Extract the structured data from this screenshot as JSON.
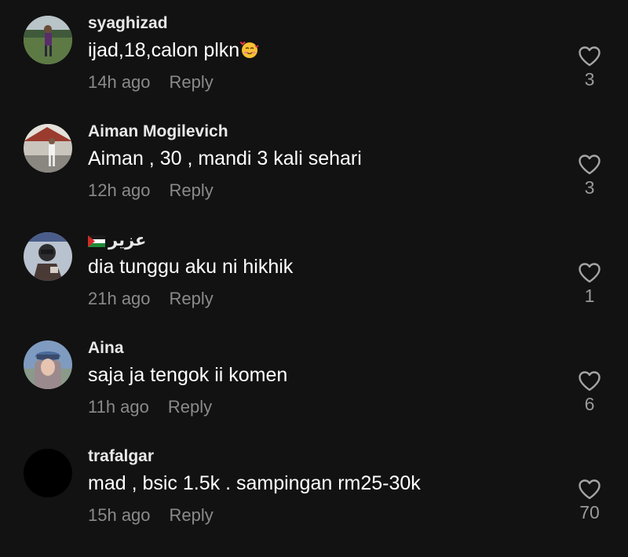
{
  "comments": [
    {
      "username": "syaghizad",
      "flag": false,
      "text": "ijad,18,calon plkn",
      "emoji": "smiling-face-with-hearts",
      "time": "14h ago",
      "reply": "Reply",
      "likes": "3"
    },
    {
      "username": "Aiman Mogilevich",
      "flag": false,
      "text": "Aiman , 30 , mandi 3 kali sehari",
      "emoji": "",
      "time": "12h ago",
      "reply": "Reply",
      "likes": "3"
    },
    {
      "username": "عزير",
      "flag": true,
      "text": "dia tunggu aku ni hikhik",
      "emoji": "",
      "time": "21h ago",
      "reply": "Reply",
      "likes": "1"
    },
    {
      "username": "Aina",
      "flag": false,
      "text": "saja ja tengok ii komen",
      "emoji": "",
      "time": "11h ago",
      "reply": "Reply",
      "likes": "6"
    },
    {
      "username": "trafalgar",
      "flag": false,
      "text": "mad , bsic 1.5k . sampingan rm25-30k",
      "emoji": "",
      "time": "15h ago",
      "reply": "Reply",
      "likes": "70"
    }
  ],
  "colors": {
    "background": "#121212",
    "meta": "#8a8a8a",
    "text": "#ffffff"
  }
}
